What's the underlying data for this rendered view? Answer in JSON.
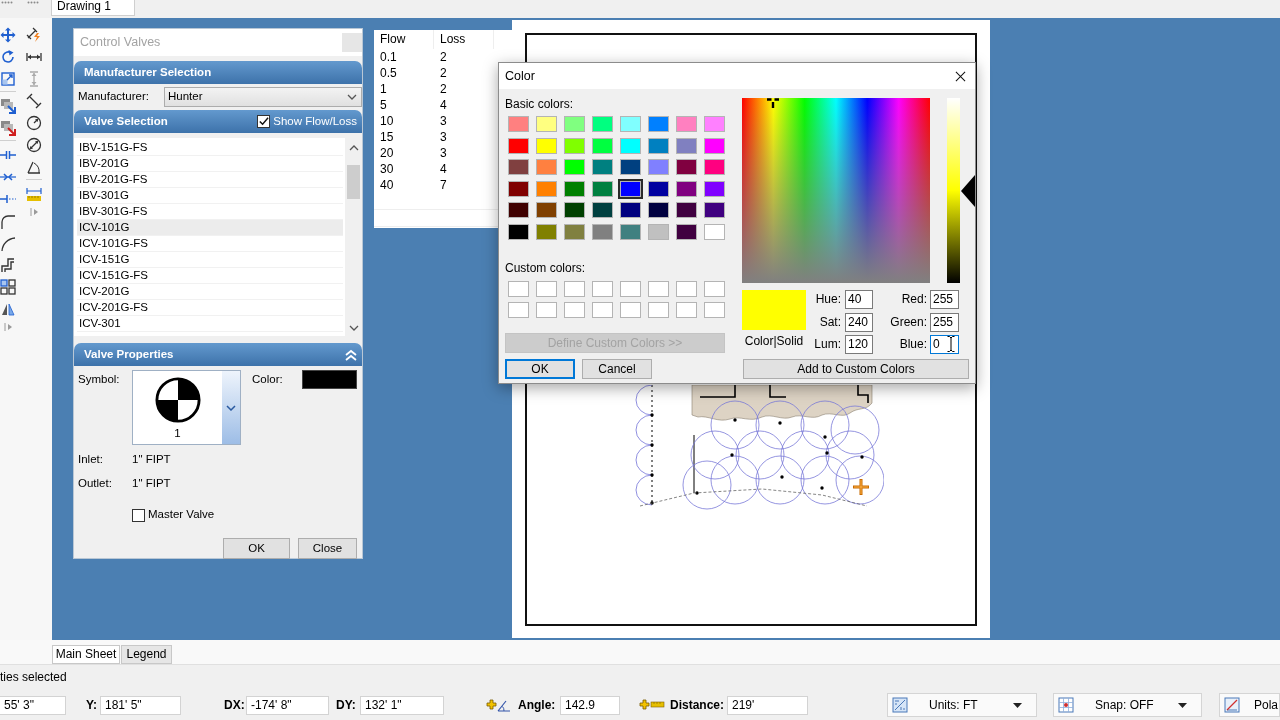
{
  "document_tab": {
    "label": "Drawing 1",
    "selected": true
  },
  "control_valves": {
    "title": "Control Valves",
    "manufacturer_selection": {
      "title": "Manufacturer Selection",
      "label": "Manufacturer:",
      "value": "Hunter"
    },
    "valve_selection": {
      "title": "Valve Selection",
      "show_flow_loss": {
        "label": "Show Flow/Loss",
        "checked": true
      },
      "valves": [
        {
          "name": "IBV-151G-FS",
          "selected": false
        },
        {
          "name": "IBV-201G",
          "selected": false
        },
        {
          "name": "IBV-201G-FS",
          "selected": false
        },
        {
          "name": "IBV-301G",
          "selected": false
        },
        {
          "name": "IBV-301G-FS",
          "selected": false
        },
        {
          "name": "ICV-101G",
          "selected": true
        },
        {
          "name": "ICV-101G-FS",
          "selected": false
        },
        {
          "name": "ICV-151G",
          "selected": false
        },
        {
          "name": "ICV-151G-FS",
          "selected": false
        },
        {
          "name": "ICV-201G",
          "selected": false
        },
        {
          "name": "ICV-201G-FS",
          "selected": false
        },
        {
          "name": "ICV-301",
          "selected": false
        }
      ]
    },
    "valve_properties": {
      "title": "Valve Properties",
      "symbol_label": "Symbol:",
      "symbol_number": "1",
      "color_label": "Color:",
      "color": "#000000",
      "inlet_label": "Inlet:",
      "inlet": "1\" FIPT",
      "outlet_label": "Outlet:",
      "outlet": "1\" FIPT",
      "master_valve": {
        "label": "Master Valve",
        "checked": false
      }
    },
    "buttons": [
      {
        "label": "OK"
      },
      {
        "label": "Close"
      }
    ]
  },
  "flow_loss_table": {
    "columns": [
      "Flow",
      "Loss"
    ],
    "rows": [
      [
        "0.1",
        "2"
      ],
      [
        "0.5",
        "2"
      ],
      [
        "1",
        "2"
      ],
      [
        "5",
        "4"
      ],
      [
        "10",
        "3"
      ],
      [
        "15",
        "3"
      ],
      [
        "20",
        "3"
      ],
      [
        "30",
        "4"
      ],
      [
        "40",
        "7"
      ]
    ]
  },
  "color_dialog": {
    "title": "Color",
    "basic_colors_label": "Basic colors:",
    "basic_colors": [
      {
        "color": "#ff8080",
        "selected": false
      },
      {
        "color": "#ffff80",
        "selected": false
      },
      {
        "color": "#80ff80",
        "selected": false
      },
      {
        "color": "#00ff80",
        "selected": false
      },
      {
        "color": "#80ffff",
        "selected": false
      },
      {
        "color": "#0080ff",
        "selected": false
      },
      {
        "color": "#ff80c0",
        "selected": false
      },
      {
        "color": "#ff80ff",
        "selected": false
      },
      {
        "color": "#ff0000",
        "selected": false
      },
      {
        "color": "#ffff00",
        "selected": false
      },
      {
        "color": "#80ff00",
        "selected": false
      },
      {
        "color": "#00ff40",
        "selected": false
      },
      {
        "color": "#00ffff",
        "selected": false
      },
      {
        "color": "#0080c0",
        "selected": false
      },
      {
        "color": "#8080c0",
        "selected": false
      },
      {
        "color": "#ff00ff",
        "selected": false
      },
      {
        "color": "#804040",
        "selected": false
      },
      {
        "color": "#ff8040",
        "selected": false
      },
      {
        "color": "#00ff00",
        "selected": false
      },
      {
        "color": "#008080",
        "selected": false
      },
      {
        "color": "#004080",
        "selected": false
      },
      {
        "color": "#8080ff",
        "selected": false
      },
      {
        "color": "#800040",
        "selected": false
      },
      {
        "color": "#ff0080",
        "selected": false
      },
      {
        "color": "#800000",
        "selected": false
      },
      {
        "color": "#ff8000",
        "selected": false
      },
      {
        "color": "#008000",
        "selected": false
      },
      {
        "color": "#008040",
        "selected": false
      },
      {
        "color": "#0000ff",
        "selected": true
      },
      {
        "color": "#0000a0",
        "selected": false
      },
      {
        "color": "#800080",
        "selected": false
      },
      {
        "color": "#8000ff",
        "selected": false
      },
      {
        "color": "#400000",
        "selected": false
      },
      {
        "color": "#804000",
        "selected": false
      },
      {
        "color": "#004000",
        "selected": false
      },
      {
        "color": "#004040",
        "selected": false
      },
      {
        "color": "#000080",
        "selected": false
      },
      {
        "color": "#000040",
        "selected": false
      },
      {
        "color": "#400040",
        "selected": false
      },
      {
        "color": "#400080",
        "selected": false
      },
      {
        "color": "#000000",
        "selected": false
      },
      {
        "color": "#808000",
        "selected": false
      },
      {
        "color": "#808040",
        "selected": false
      },
      {
        "color": "#808080",
        "selected": false
      },
      {
        "color": "#408080",
        "selected": false
      },
      {
        "color": "#c0c0c0",
        "selected": false
      },
      {
        "color": "#400040",
        "selected": false
      },
      {
        "color": "#ffffff",
        "selected": false
      }
    ],
    "custom_colors_label": "Custom colors:",
    "custom_colors": [
      {
        "color": "#ffffff"
      },
      {
        "color": "#ffffff"
      },
      {
        "color": "#ffffff"
      },
      {
        "color": "#ffffff"
      },
      {
        "color": "#ffffff"
      },
      {
        "color": "#ffffff"
      },
      {
        "color": "#ffffff"
      },
      {
        "color": "#ffffff"
      },
      {
        "color": "#ffffff"
      },
      {
        "color": "#ffffff"
      },
      {
        "color": "#ffffff"
      },
      {
        "color": "#ffffff"
      },
      {
        "color": "#ffffff"
      },
      {
        "color": "#ffffff"
      },
      {
        "color": "#ffffff"
      },
      {
        "color": "#ffffff"
      }
    ],
    "define_custom_colors": {
      "label": "Define Custom Colors >>",
      "disabled": true
    },
    "buttons": [
      {
        "label": "OK",
        "default": true
      },
      {
        "label": "Cancel",
        "default": false
      }
    ],
    "luminance_slider": {
      "level": 0.5
    },
    "preview_label": "Color|Solid",
    "hsl_fields": [
      {
        "label": "Hue:",
        "value": "40",
        "focused": false
      },
      {
        "label": "Sat:",
        "value": "240",
        "focused": false
      },
      {
        "label": "Lum:",
        "value": "120",
        "focused": false
      }
    ],
    "rgb_fields": [
      {
        "label": "Red:",
        "value": "255",
        "focused": false
      },
      {
        "label": "Green:",
        "value": "255",
        "focused": false
      },
      {
        "label": "Blue:",
        "value": "0",
        "focused": true
      }
    ],
    "add_to_custom_colors": {
      "label": "Add to Custom Colors"
    }
  },
  "sheet_tabs": [
    {
      "label": "Main Sheet",
      "selected": true
    },
    {
      "label": "Legend",
      "selected": false
    }
  ],
  "status_bar": {
    "message": "ties selected",
    "coordinates": [
      {
        "value": "55' 3\""
      },
      {
        "label": "Y:",
        "value": "181' 5\""
      },
      {
        "label": "DX:",
        "value": "-174' 8\""
      },
      {
        "label": "DY:",
        "value": "132' 1\""
      }
    ],
    "angle": {
      "label": "Angle:",
      "value": "142.9"
    },
    "distance": {
      "label": "Distance:",
      "value": "219'"
    },
    "mode_buttons": [
      {
        "kind": "dropdown",
        "label": "Units: FT"
      },
      {
        "kind": "dropdown",
        "label": "Snap: OFF"
      },
      {
        "kind": "button",
        "label": "Pola"
      }
    ]
  }
}
